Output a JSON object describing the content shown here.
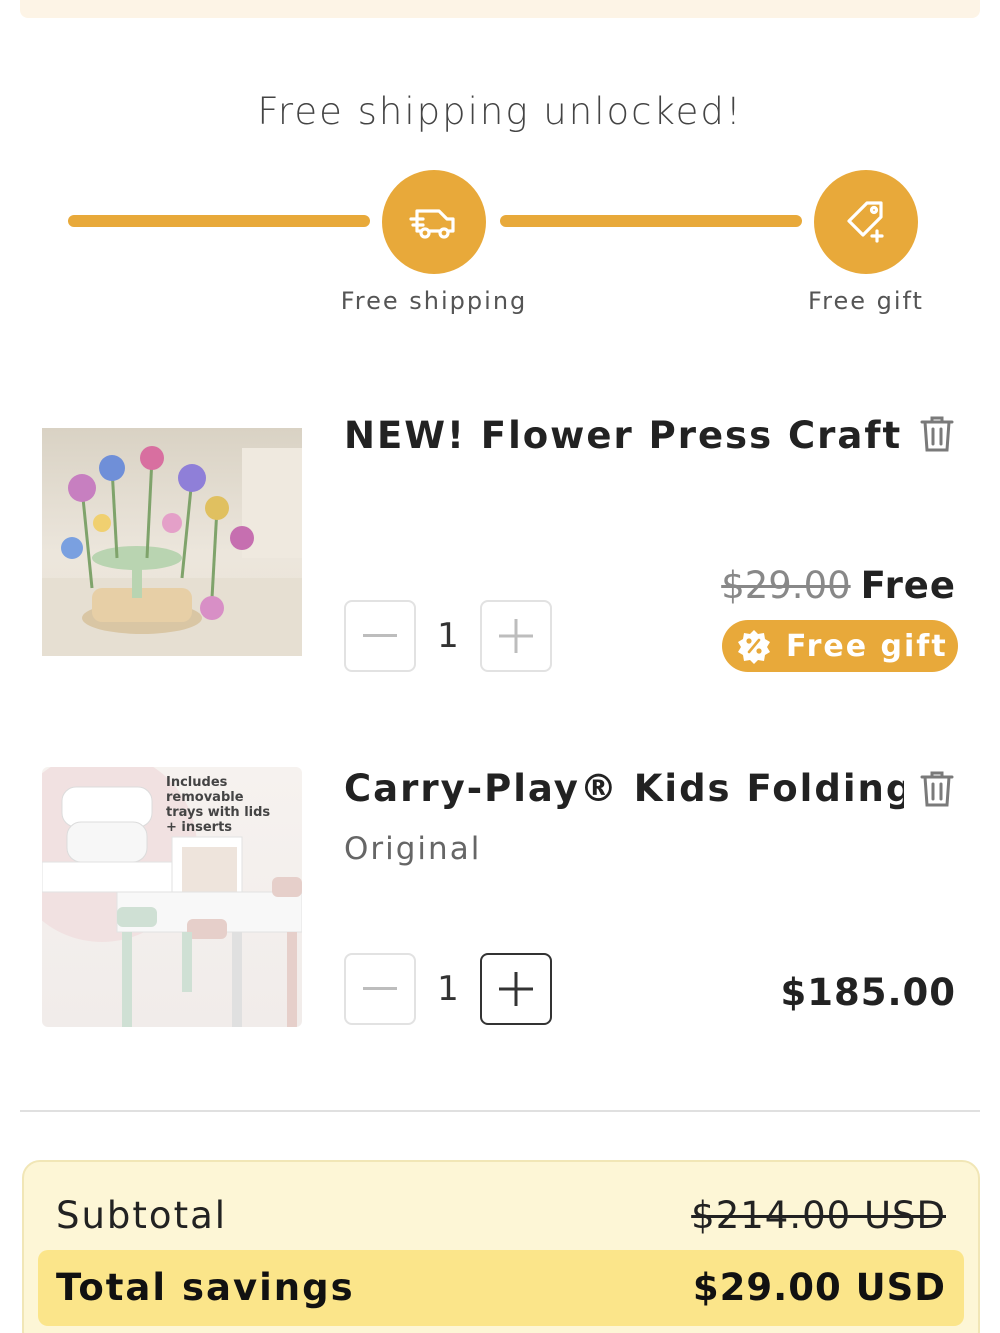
{
  "progress": {
    "title": "Free shipping unlocked!",
    "milestones": [
      {
        "label": "Free shipping",
        "icon": "truck-icon"
      },
      {
        "label": "Free gift",
        "icon": "gift-tag-icon"
      }
    ],
    "fill_fraction": 1.0,
    "accent_color": "#e8a93a"
  },
  "items": [
    {
      "title": "NEW! Flower Press Craft ...",
      "variant": "",
      "quantity": "1",
      "old_price": "$29.00",
      "price": "Free",
      "badge": "Free gift"
    },
    {
      "title": "Carry-Play® Kids Folding ...",
      "variant": "Original",
      "quantity": "1",
      "old_price": "",
      "price": "$185.00",
      "image_text": [
        "Includes removable",
        "trays with lids",
        "+ inserts"
      ]
    }
  ],
  "summary": {
    "subtotal_label": "Subtotal",
    "subtotal_value": "$214.00 USD",
    "savings_label": "Total savings",
    "savings_value": "$29.00 USD"
  }
}
